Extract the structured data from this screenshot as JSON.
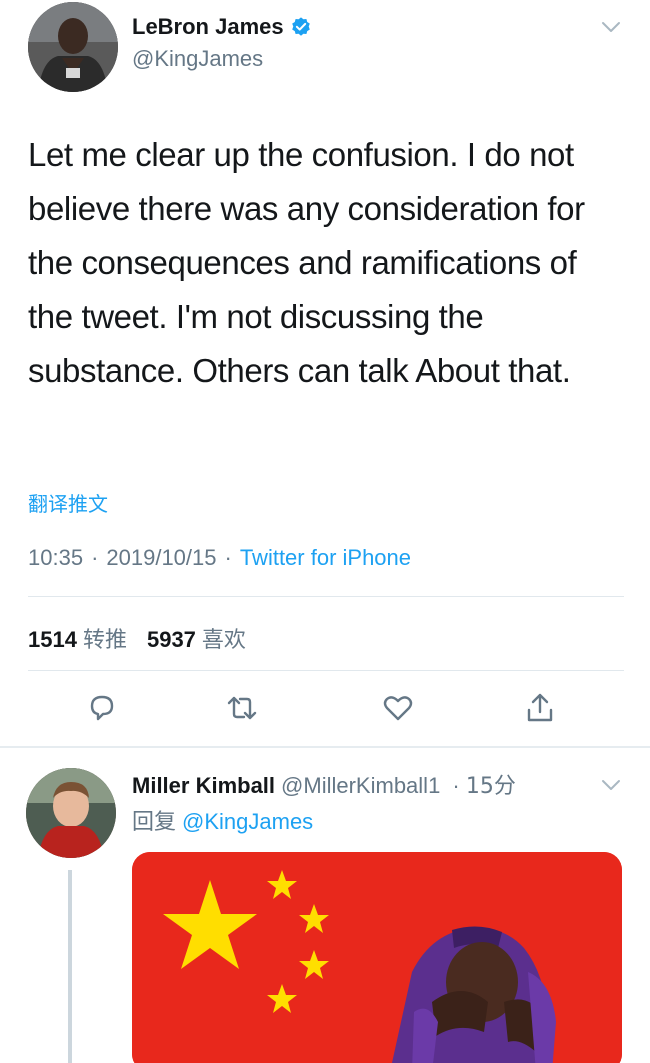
{
  "tweet": {
    "display_name": "LeBron James",
    "handle": "@KingJames",
    "text": "Let me clear up the confusion. I do not believe there was any consideration for the consequences and ramifications of the tweet.  I'm not discussing the substance.  Others can talk About that.",
    "translate_label": "翻译推文",
    "time": "10:35",
    "date": "2019/10/15",
    "source": "Twitter for iPhone",
    "retweets_count": "1514",
    "retweets_label": "转推",
    "likes_count": "5937",
    "likes_label": "喜欢"
  },
  "reply": {
    "display_name": "Miller Kimball",
    "handle": "@MillerKimball1",
    "time": "15分",
    "replying_label": "回复",
    "replying_to": "@KingJames"
  },
  "colors": {
    "accent": "#1da1f2",
    "text": "#14171a",
    "secondary": "#657786",
    "flag_red": "#e8281c",
    "flag_star": "#ffde00"
  }
}
